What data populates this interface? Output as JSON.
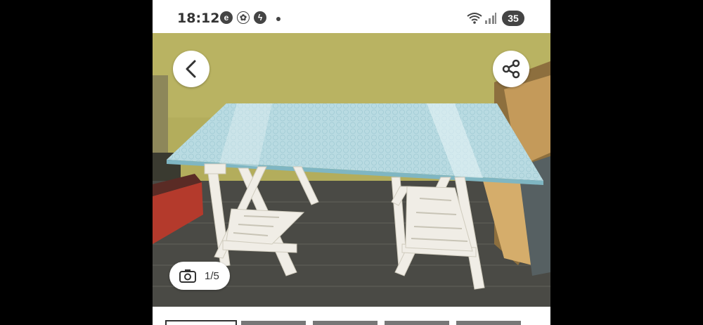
{
  "status_bar": {
    "time": "18:12",
    "notification_icons": [
      "edge-browser-icon",
      "ladybug-icon",
      "messenger-icon"
    ],
    "battery": "35",
    "icons": [
      "wifi-icon",
      "signal-icon"
    ]
  },
  "gallery": {
    "counter_text": "1/5",
    "current_index": 1,
    "total": 5,
    "back_icon": "chevron-left-icon",
    "share_icon": "share-icon",
    "camera_icon": "camera-icon"
  },
  "colors": {
    "wall": "#b8b25e",
    "floor": "#4a4a44",
    "glass": "#bfe0ea",
    "trestle": "#f0ede4"
  }
}
